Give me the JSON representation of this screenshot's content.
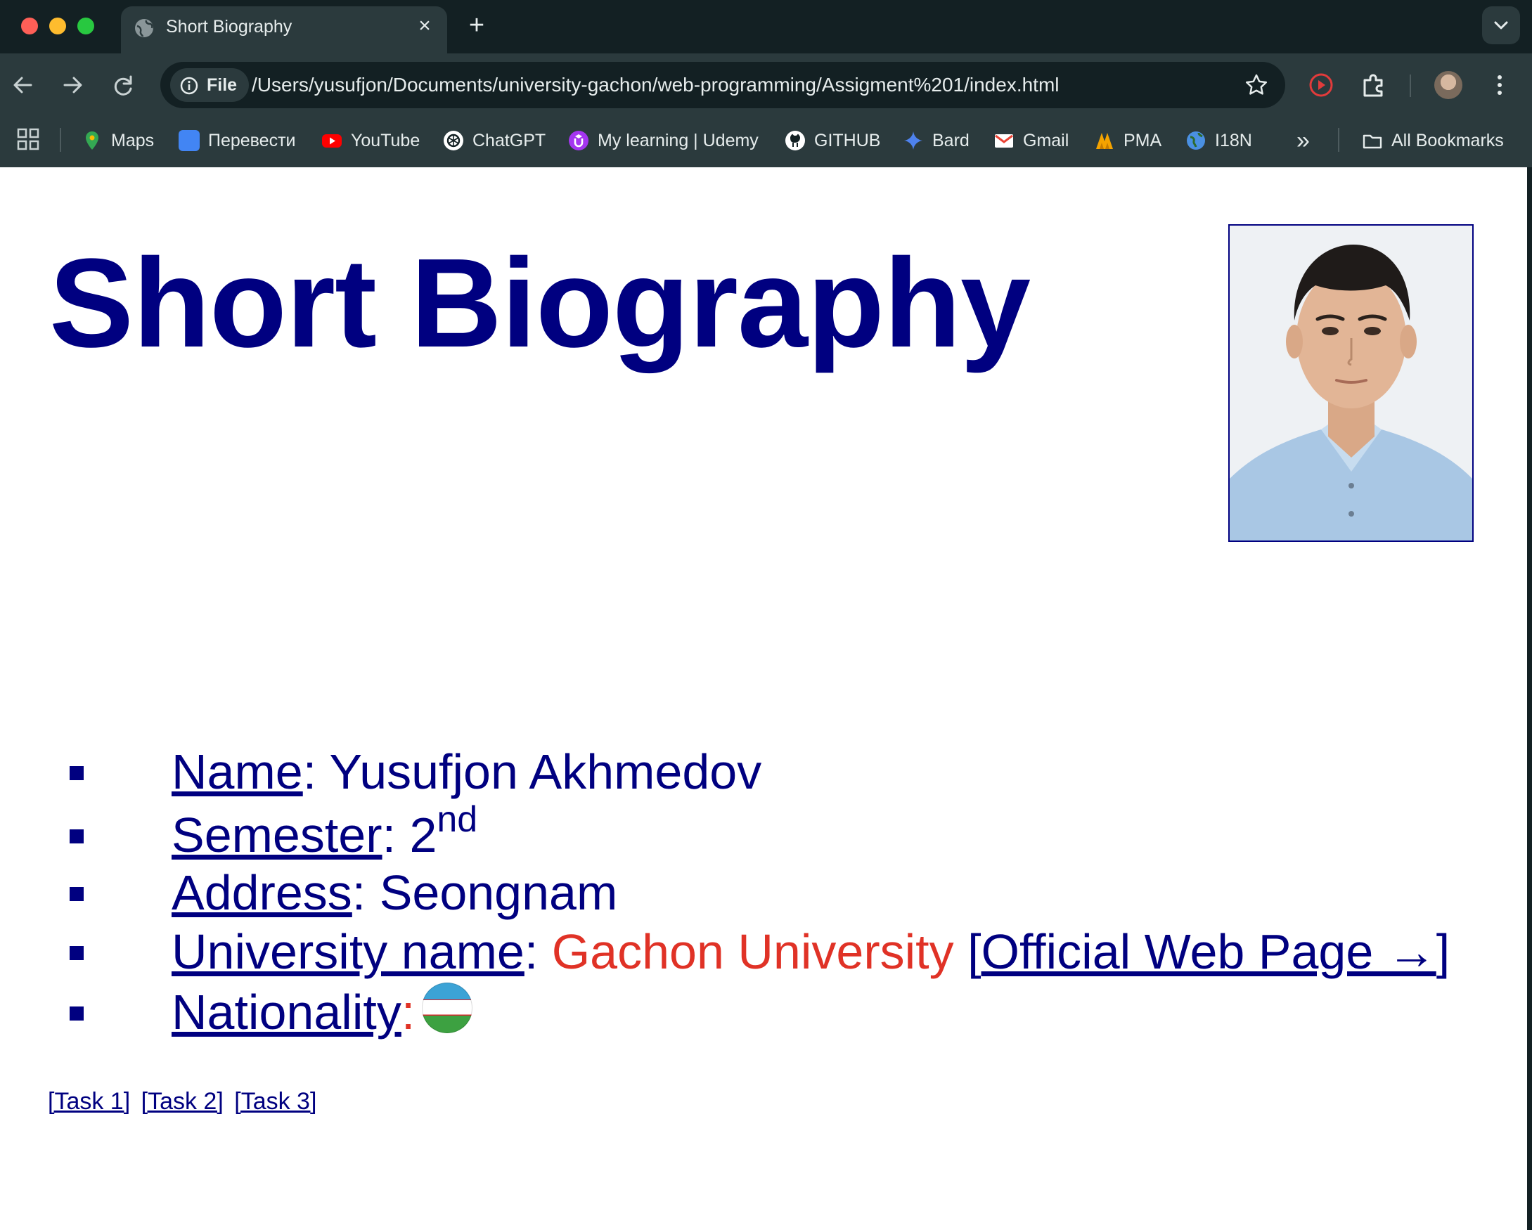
{
  "browser": {
    "tab": {
      "title": "Short Biography"
    },
    "omnibox": {
      "chip_label": "File",
      "url": "/Users/yusufjon/Documents/university-gachon/web-programming/Assigment%201/index.html"
    },
    "bookmarks": [
      {
        "label": "Maps",
        "icon": "maps-icon",
        "color": "#34a853"
      },
      {
        "label": "Перевести",
        "icon": "google-translate-icon",
        "color": "#4285f4"
      },
      {
        "label": "YouTube",
        "icon": "youtube-icon",
        "color": "#ff0000"
      },
      {
        "label": "ChatGPT",
        "icon": "chatgpt-icon",
        "color": "#ffffff"
      },
      {
        "label": "My learning | Udemy",
        "icon": "udemy-icon",
        "color": "#a435f0"
      },
      {
        "label": "GITHUB",
        "icon": "github-icon",
        "color": "#ffffff"
      },
      {
        "label": "Bard",
        "icon": "bard-icon",
        "color": "#4e82ee"
      },
      {
        "label": "Gmail",
        "icon": "gmail-icon",
        "color": "#ea4335"
      },
      {
        "label": "PMA",
        "icon": "pma-icon",
        "color": "#f4a300"
      },
      {
        "label": "I18N",
        "icon": "globe-icon",
        "color": "#4a90e2"
      }
    ],
    "bookmarks_overflow": "»",
    "all_bookmarks": "All Bookmarks"
  },
  "page": {
    "title": "Short Biography",
    "photo_alt": "portrait photo",
    "bio": {
      "name_label": "Name",
      "name_value": ": Yusufjon Akhmedov",
      "semester_label": "Semester",
      "semester_value": ": 2",
      "semester_sup": "nd",
      "address_label": "Address",
      "address_value": ": Seongnam",
      "university_label": "University name",
      "university_colon": ": ",
      "university_value": "Gachon University",
      "official_open": " [",
      "official_link": "Official Web Page →",
      "official_close": "]",
      "nationality_label": "Nationality",
      "nationality_colon": ":",
      "nationality_flag": "uzbekistan-flag"
    },
    "tasks": [
      "[Task 1]",
      "[Task 2]",
      "[Task 3]"
    ]
  },
  "colors": {
    "text_navy": "#000080",
    "accent_red": "#e03226",
    "chrome_dark": "#132023",
    "chrome_mid": "#2b3a3d"
  }
}
